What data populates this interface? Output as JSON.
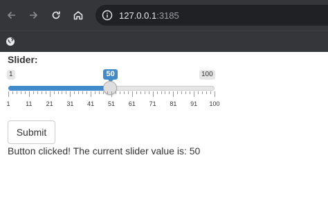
{
  "browser": {
    "url_host": "127.0.0.1",
    "url_port": ":3185",
    "icons": [
      "back-icon",
      "forward-icon",
      "reload-icon",
      "home-icon",
      "info-icon",
      "globe-icon"
    ]
  },
  "slider": {
    "label": "Slider:",
    "min": 1,
    "max": 100,
    "value": 50,
    "min_label": "1",
    "max_label": "100",
    "value_label": "50",
    "tick_labels": [
      "1",
      "11",
      "21",
      "31",
      "41",
      "51",
      "61",
      "71",
      "81",
      "91",
      "100"
    ],
    "accent_color": "#428bca"
  },
  "form": {
    "submit_label": "Submit",
    "result_text": "Button clicked! The current slider value is: 50"
  }
}
